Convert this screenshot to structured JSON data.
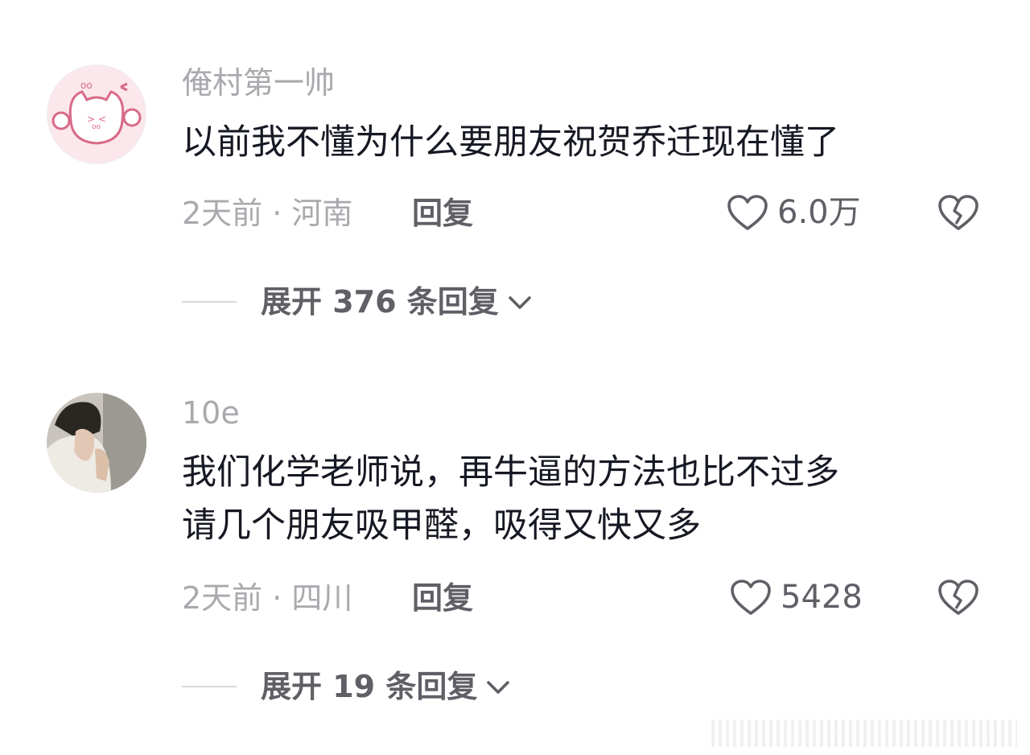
{
  "comments": [
    {
      "username": "俺村第一帅",
      "content_lines": [
        "以前我不懂为什么要朋友祝贺乔迁现在懂了"
      ],
      "meta": "2天前 · 河南",
      "reply_label": "回复",
      "like_count": "6.0万",
      "expand_label": "展开 376 条回复"
    },
    {
      "username": "10e",
      "content_lines": [
        "我们化学老师说，再牛逼的方法也比不过多",
        "请几个朋友吸甲醛，吸得又快又多"
      ],
      "meta": "2天前 · 四川",
      "reply_label": "回复",
      "like_count": "5428",
      "expand_label": "展开 19 条回复"
    }
  ],
  "colors": {
    "username": "#a9a9ae",
    "content": "#161823",
    "secondary": "#5f6066",
    "avatar1_bg": "#fbe7ec",
    "avatar2_bg": "#c9c4bd"
  },
  "icons": {
    "like": "heart-outline-icon",
    "dislike": "broken-heart-icon",
    "expand": "chevron-down-icon"
  }
}
